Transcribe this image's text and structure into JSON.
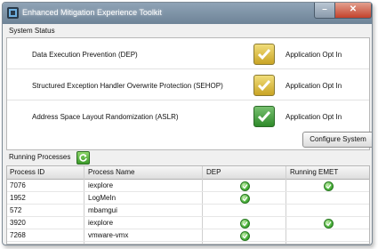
{
  "window": {
    "title": "Enhanced Mitigation Experience Toolkit",
    "close_glyph": "✕",
    "minimize_glyph": "–"
  },
  "system_status": {
    "heading": "System Status",
    "rows": [
      {
        "name": "Data Execution Prevention (DEP)",
        "value": "Application Opt In",
        "indicator": "yellow-check"
      },
      {
        "name": "Structured Exception Handler Overwrite Protection (SEHOP)",
        "value": "Application Opt In",
        "indicator": "yellow-check"
      },
      {
        "name": "Address Space Layout Randomization (ASLR)",
        "value": "Application Opt In",
        "indicator": "green-check"
      }
    ],
    "configure_label": "Configure System"
  },
  "running_processes": {
    "heading": "Running Processes",
    "columns": [
      "Process ID",
      "Process Name",
      "DEP",
      "Running EMET"
    ],
    "rows": [
      {
        "pid": "7076",
        "name": "iexplore",
        "dep": true,
        "emet": true
      },
      {
        "pid": "1952",
        "name": "LogMeIn",
        "dep": true,
        "emet": false
      },
      {
        "pid": "572",
        "name": "mbamgui",
        "dep": false,
        "emet": false
      },
      {
        "pid": "3920",
        "name": "iexplore",
        "dep": true,
        "emet": true
      },
      {
        "pid": "7268",
        "name": "vmware-vmx",
        "dep": true,
        "emet": false
      }
    ]
  },
  "colors": {
    "title_bar": "#7d92a6",
    "yellow_check": "#d8b434",
    "green_check": "#3e9a36",
    "status_dot": "#49b23a"
  }
}
